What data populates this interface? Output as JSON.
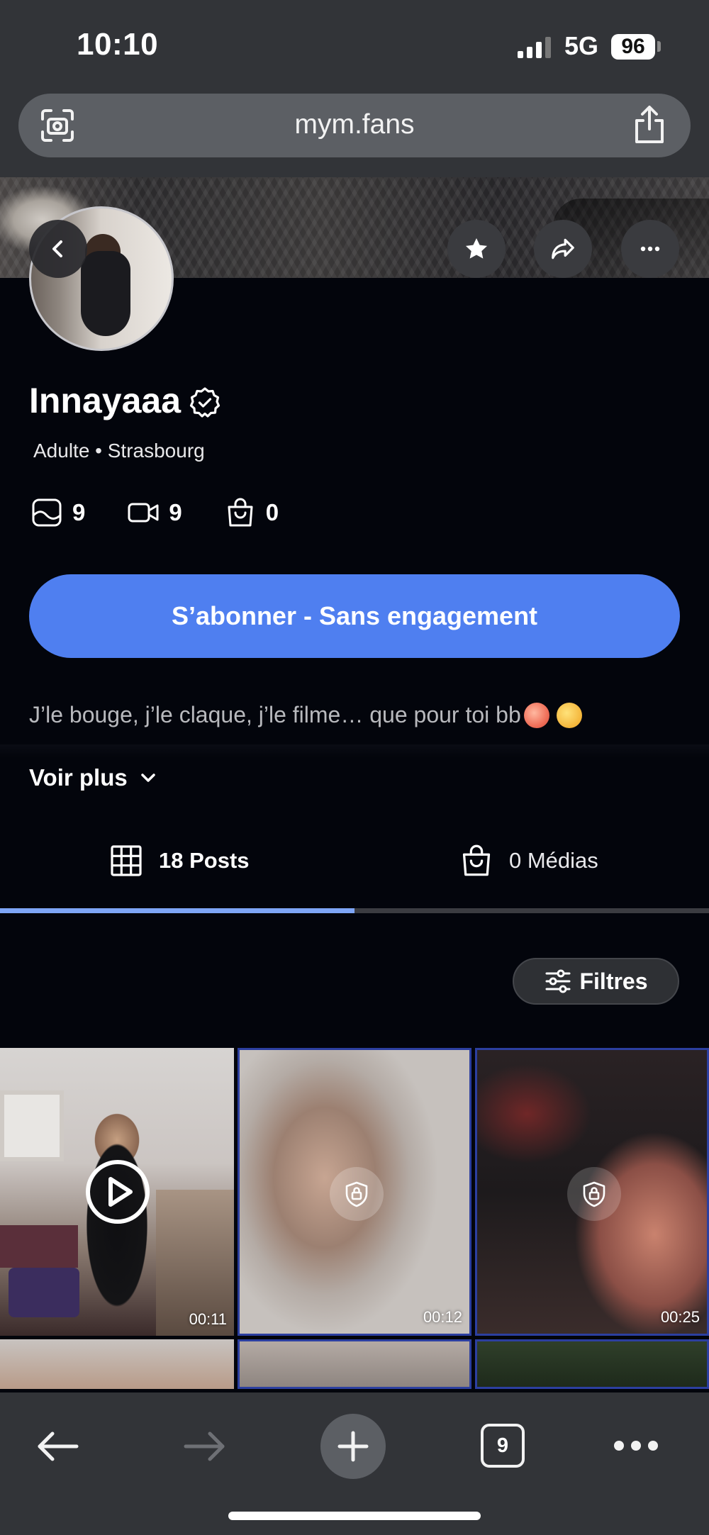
{
  "status_bar": {
    "time": "10:10",
    "network": "5G",
    "battery": "96"
  },
  "browser": {
    "url": "mym.fans",
    "tab_count": "9"
  },
  "profile": {
    "name": "Innayaaa",
    "meta": "Adulte • Strasbourg",
    "stats": {
      "photos": "9",
      "videos": "9",
      "purchases": "0"
    },
    "subscribe_label": "S’abonner - Sans engagement",
    "bio": "J’le bouge, j’le claque, j’le filme… que pour toi bb",
    "see_more_label": "Voir plus"
  },
  "tabs": [
    {
      "label": "18 Posts",
      "active": true
    },
    {
      "label": "0 Médias",
      "active": false
    }
  ],
  "filters_label": "Filtres",
  "grid": [
    {
      "type": "video",
      "locked": false,
      "duration": "00:11"
    },
    {
      "type": "video",
      "locked": true,
      "duration": "00:12"
    },
    {
      "type": "video",
      "locked": true,
      "duration": "00:25"
    }
  ],
  "icons": [
    "scan-icon",
    "share-icon",
    "back-chevron-icon",
    "star-icon",
    "forward-share-icon",
    "more-icon",
    "verified-icon",
    "photo-icon",
    "video-icon",
    "bag-icon",
    "chevron-down-icon",
    "grid-icon",
    "sliders-icon",
    "play-icon",
    "lock-icon",
    "arrow-left-icon",
    "arrow-right-icon",
    "plus-icon"
  ],
  "colors": {
    "accent": "#4f7ff0",
    "tab_indicator": "#7ea6f6",
    "background": "#03050c",
    "browser_chrome": "#323438"
  }
}
